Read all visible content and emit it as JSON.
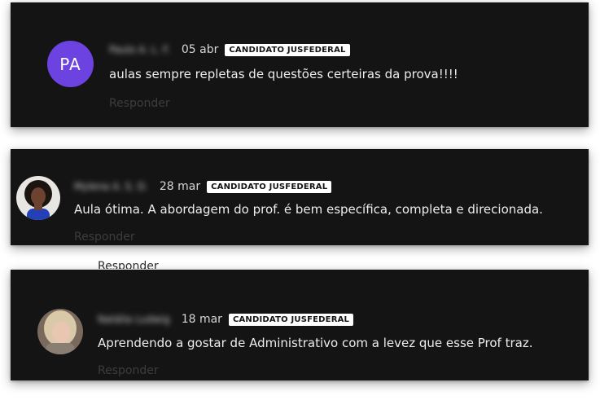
{
  "comments": [
    {
      "author": "Paulo A. L. F.",
      "avatar_initials": "PA",
      "date": "05 abr",
      "badge": "CANDIDATO JUSFEDERAL",
      "text": "aulas sempre repletas de questões certeiras da prova!!!!",
      "reply_label": "Responder"
    },
    {
      "author": "Mylena A. S. D.",
      "date": "28 mar",
      "badge": "CANDIDATO JUSFEDERAL",
      "text": "Aula ótima. A abordagem do prof. é bem específica, completa e direcionada.",
      "reply_label": "Responder"
    },
    {
      "author": "Natália Ludwig",
      "date": "18 mar",
      "badge": "CANDIDATO JUSFEDERAL",
      "text": "Aprendendo a gostar de Administrativo com a levez que esse Prof traz.",
      "reply_label": "Responder"
    }
  ],
  "ghost_reply_label": "Responder",
  "colors": {
    "card_bg": "#151415",
    "avatar_purple": "#6c43e0",
    "badge_bg": "#ffffff"
  }
}
